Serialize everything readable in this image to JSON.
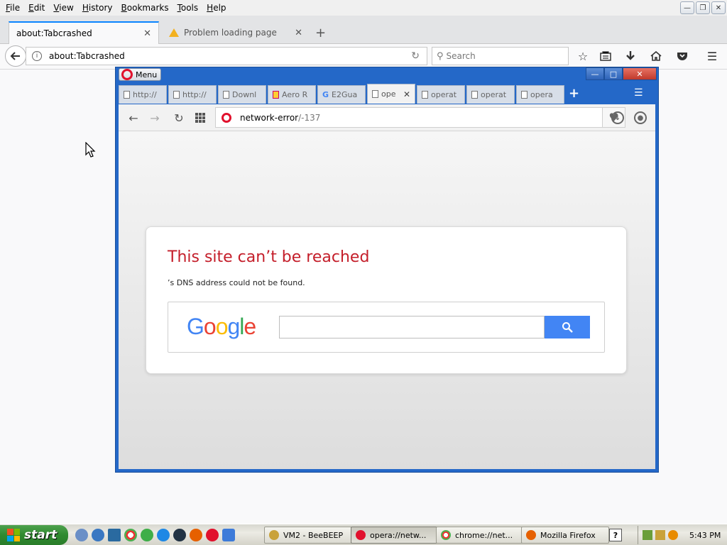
{
  "firefox": {
    "menus": [
      {
        "label": "File",
        "accel": "F",
        "rest": "ile"
      },
      {
        "label": "Edit",
        "accel": "E",
        "rest": "dit"
      },
      {
        "label": "View",
        "accel": "V",
        "rest": "iew"
      },
      {
        "label": "History",
        "accel": "H",
        "rest": "istory"
      },
      {
        "label": "Bookmarks",
        "accel": "B",
        "rest": "ookmarks"
      },
      {
        "label": "Tools",
        "accel": "T",
        "rest": "ools"
      },
      {
        "label": "Help",
        "accel": "H",
        "rest": "elp"
      }
    ],
    "tabs": {
      "active_title": "about:Tabcrashed",
      "inactive_title": "Problem loading page"
    },
    "urlbar": {
      "value": "about:Tabcrashed"
    },
    "search": {
      "placeholder": "Search"
    }
  },
  "opera": {
    "menu_label": "Menu",
    "tabs": [
      {
        "title": "http://",
        "icon": "page-icon"
      },
      {
        "title": "http://",
        "icon": "page-icon"
      },
      {
        "title": "Downl",
        "icon": "download-icon"
      },
      {
        "title": "Aero R",
        "icon": "aero-icon"
      },
      {
        "title": "E2Gua",
        "icon": "google-icon"
      },
      {
        "title": "ope",
        "icon": "page-icon",
        "active": true
      },
      {
        "title": "operat",
        "icon": "page-icon"
      },
      {
        "title": "operat",
        "icon": "page-icon"
      },
      {
        "title": "opera",
        "icon": "page-icon"
      }
    ],
    "address": {
      "host": "network-error",
      "path": "/-137"
    },
    "error": {
      "title": "This site can’t be reached",
      "description": "’s DNS address could not be found."
    },
    "google": {
      "letters": [
        {
          "ch": "G",
          "color": "#4285f4"
        },
        {
          "ch": "o",
          "color": "#ea4335"
        },
        {
          "ch": "o",
          "color": "#fbbc05"
        },
        {
          "ch": "g",
          "color": "#4285f4"
        },
        {
          "ch": "l",
          "color": "#34a853"
        },
        {
          "ch": "e",
          "color": "#ea4335"
        }
      ]
    }
  },
  "taskbar": {
    "start_label": "start",
    "buttons": [
      {
        "label": "VM2 - BeeBEEP",
        "icon_color": "#c9a23a"
      },
      {
        "label": "opera://netw...",
        "icon_color": "#e1112d",
        "active": true
      },
      {
        "label": "chrome://net...",
        "icon_color": "#4caf50"
      },
      {
        "label": "Mozilla Firefox",
        "icon_color": "#e66000"
      }
    ],
    "help_label": "?",
    "clock": "5:43 PM"
  },
  "colors": {
    "error_title": "#c41e2a",
    "google_button": "#4285f4",
    "opera_frame": "#2468c8",
    "firefox_tab_accent": "#0a84ff"
  }
}
